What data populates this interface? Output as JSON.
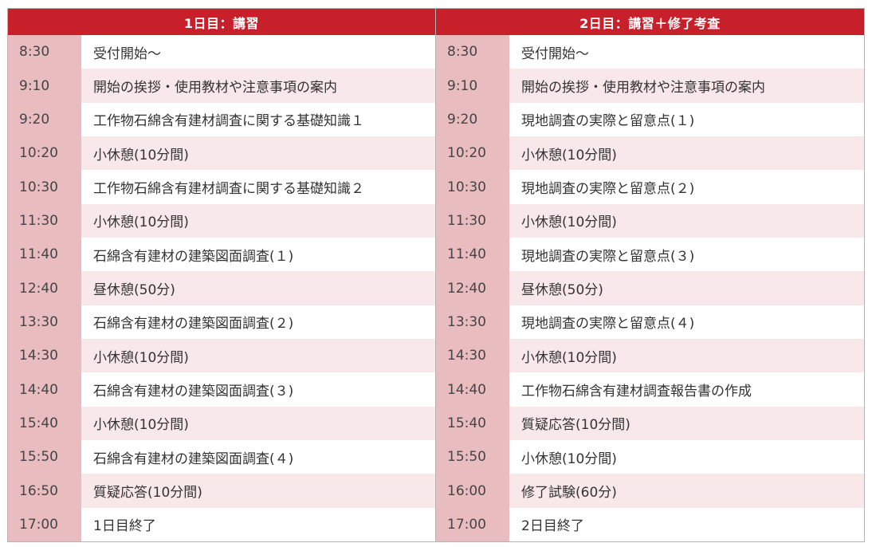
{
  "days": [
    {
      "title": "1日目：講習",
      "rows": [
        {
          "time": "8:30",
          "text": "受付開始～"
        },
        {
          "time": "9:10",
          "text": "開始の挨拶・使用教材や注意事項の案内"
        },
        {
          "time": "9:20",
          "text": "工作物石綿含有建材調査に関する基礎知識１"
        },
        {
          "time": "10:20",
          "text": "小休憩(10分間)"
        },
        {
          "time": "10:30",
          "text": "工作物石綿含有建材調査に関する基礎知識２"
        },
        {
          "time": "11:30",
          "text": "小休憩(10分間)"
        },
        {
          "time": "11:40",
          "text": "石綿含有建材の建築図面調査(１)"
        },
        {
          "time": "12:40",
          "text": "昼休憩(50分)"
        },
        {
          "time": "13:30",
          "text": "石綿含有建材の建築図面調査(２)"
        },
        {
          "time": "14:30",
          "text": "小休憩(10分間)"
        },
        {
          "time": "14:40",
          "text": "石綿含有建材の建築図面調査(３)"
        },
        {
          "time": "15:40",
          "text": "小休憩(10分間)"
        },
        {
          "time": "15:50",
          "text": "石綿含有建材の建築図面調査(４)"
        },
        {
          "time": "16:50",
          "text": "質疑応答(10分間)"
        },
        {
          "time": "17:00",
          "text": "1日目終了"
        }
      ]
    },
    {
      "title": "2日目：講習＋修了考査",
      "rows": [
        {
          "time": "8:30",
          "text": "受付開始～"
        },
        {
          "time": "9:10",
          "text": "開始の挨拶・使用教材や注意事項の案内"
        },
        {
          "time": "9:20",
          "text": "現地調査の実際と留意点(１)"
        },
        {
          "time": "10:20",
          "text": "小休憩(10分間)"
        },
        {
          "time": "10:30",
          "text": "現地調査の実際と留意点(２)"
        },
        {
          "time": "11:30",
          "text": "小休憩(10分間)"
        },
        {
          "time": "11:40",
          "text": "現地調査の実際と留意点(３)"
        },
        {
          "time": "12:40",
          "text": "昼休憩(50分)"
        },
        {
          "time": "13:30",
          "text": "現地調査の実際と留意点(４)"
        },
        {
          "time": "14:30",
          "text": "小休憩(10分間)"
        },
        {
          "time": "14:40",
          "text": "工作物石綿含有建材調査報告書の作成"
        },
        {
          "time": "15:40",
          "text": "質疑応答(10分間)"
        },
        {
          "time": "15:50",
          "text": "小休憩(10分間)"
        },
        {
          "time": "16:00",
          "text": "修了試験(60分)"
        },
        {
          "time": "17:00",
          "text": "2日目終了"
        }
      ]
    }
  ],
  "colors": {
    "header_bg": "#c8202b",
    "time_bg": "#e9bcc0",
    "stripe_bg": "#f9e8ea"
  }
}
